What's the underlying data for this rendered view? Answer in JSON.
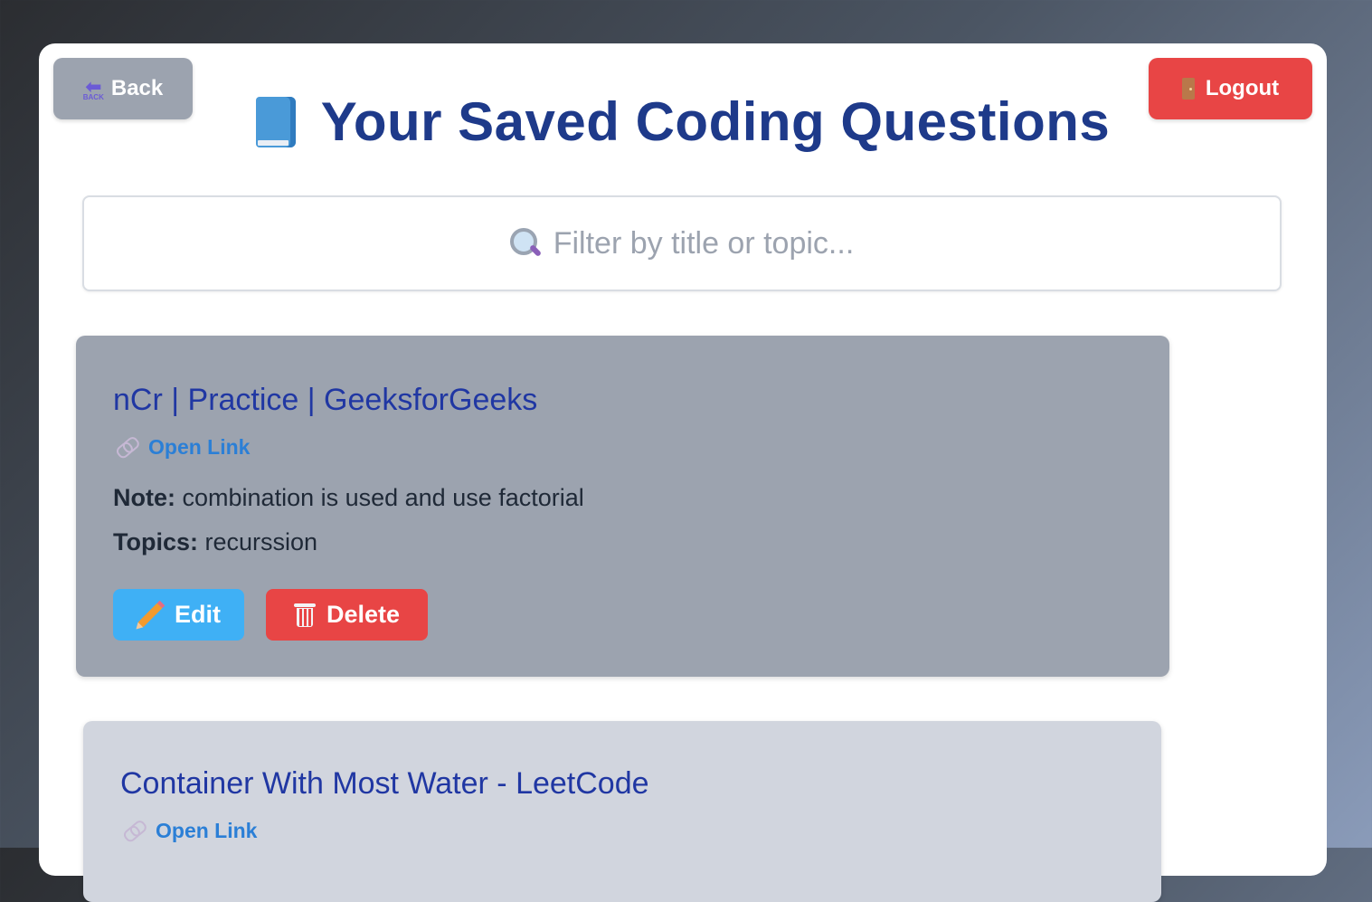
{
  "header": {
    "back_label": "Back",
    "back_icon_text": "BACK",
    "logout_label": "Logout",
    "title": "Your Saved Coding Questions"
  },
  "search": {
    "placeholder": "Filter by title or topic..."
  },
  "cards": [
    {
      "title": "nCr | Practice | GeeksforGeeks",
      "link_label": "Open Link",
      "note_label": "Note:",
      "note": "combination is used and use factorial",
      "topics_label": "Topics:",
      "topics": "recurssion",
      "edit_label": "Edit",
      "delete_label": "Delete"
    },
    {
      "title": "Container With Most Water - LeetCode",
      "link_label": "Open Link"
    }
  ],
  "colors": {
    "title": "#1e3a8a",
    "link": "#2b7fd6",
    "edit": "#3fb0f5",
    "delete": "#e84545",
    "logout": "#e84545",
    "back": "#9ca3af"
  },
  "icons": {
    "back": "back-arrow-icon",
    "logout": "door-icon",
    "title": "blue-book-icon",
    "search": "magnifying-glass-icon",
    "link": "link-icon",
    "edit": "pencil-icon",
    "delete": "wastebasket-icon"
  }
}
